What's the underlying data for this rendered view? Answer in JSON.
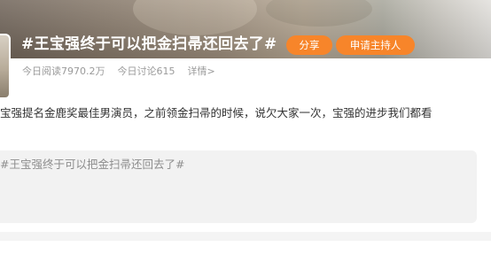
{
  "topic": {
    "title": "#王宝强终于可以把金扫帚还回去了#",
    "share_label": "分享",
    "apply_host_label": "申请主持人",
    "stats": {
      "today_reads": "今日阅读7970.2万",
      "today_discussions": "今日讨论615",
      "details_link": "详情>"
    },
    "description": "宝强提名金鹿奖最佳男演员，之前领金扫帚的时候，说欠大家一次，宝强的进步我们都看",
    "composer_text": "#王宝强终于可以把金扫帚还回去了#"
  },
  "colors": {
    "accent": "#f7852a",
    "muted_text": "#9a9a9a",
    "composer_bg": "#f2f2f2"
  }
}
